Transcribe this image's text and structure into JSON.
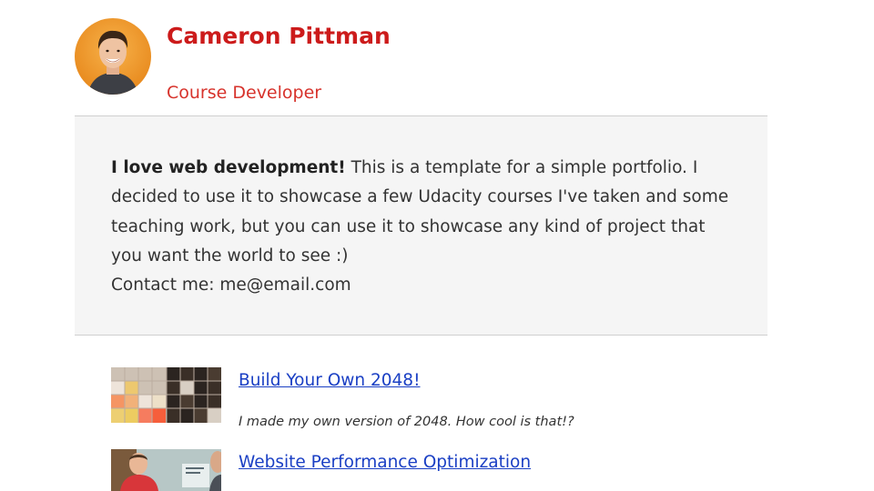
{
  "profile": {
    "name": "Cameron Pittman",
    "role": "Course Developer"
  },
  "intro": {
    "lead": "I love web development!",
    "body": " This is a template for a simple portfolio. I decided to use it to showcase a few Udacity courses I've taken and some teaching work, but you can use it to showcase any kind of project that you want the world to see :)",
    "contact": "Contact me: me@email.com"
  },
  "projects": [
    {
      "title": "Build Your Own 2048!",
      "description": "I made my own version of 2048. How cool is that!?"
    },
    {
      "title": "Website Performance Optimization",
      "description": ""
    }
  ],
  "colors": {
    "name": "#cc1b1b",
    "role": "#d7332c",
    "link": "#1a3fc4",
    "intro_bg": "#f5f5f5"
  }
}
